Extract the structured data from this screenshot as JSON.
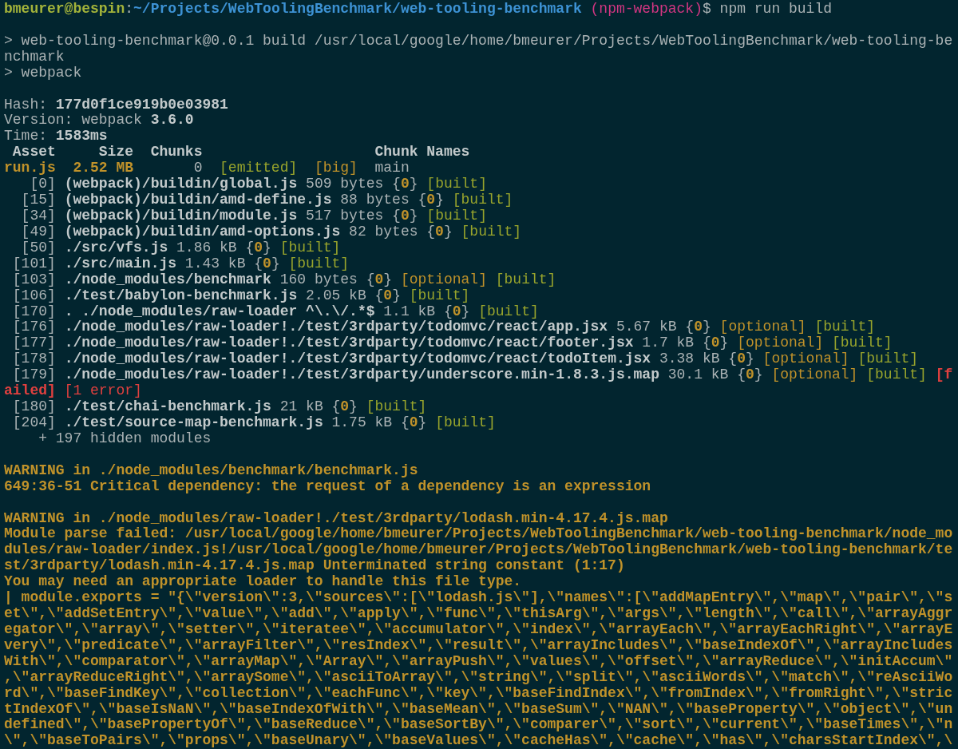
{
  "terminal": {
    "blocks": [
      {
        "lines": [
          {
            "segments": [
              {
                "kind": "user",
                "text": "bmeurer@bespin"
              },
              {
                "kind": "plain",
                "text": ":"
              },
              {
                "kind": "path",
                "text": "~/Projects/WebToolingBenchmark/web-tooling-benchmark"
              },
              {
                "kind": "branch",
                "text": " (npm-webpack)"
              },
              {
                "kind": "plain",
                "text": "$ npm run build"
              }
            ]
          }
        ]
      },
      {
        "lines": [
          {
            "segments": [
              {
                "kind": "plain",
                "text": "> web-tooling-benchmark@0.0.1 build /usr/local/google/home/bmeurer/Projects/WebToolingBenchmark/web-tooling-be"
              }
            ]
          },
          {
            "segments": [
              {
                "kind": "plain",
                "text": "nchmark"
              }
            ]
          },
          {
            "segments": [
              {
                "kind": "plain",
                "text": "> webpack"
              }
            ]
          }
        ]
      },
      {
        "lines": [
          {
            "segments": [
              {
                "kind": "plain",
                "text": "Hash: "
              },
              {
                "kind": "bold",
                "text": "177d0f1ce919b0e03981"
              }
            ]
          },
          {
            "segments": [
              {
                "kind": "plain",
                "text": "Version: webpack "
              },
              {
                "kind": "bold",
                "text": "3.6.0"
              }
            ]
          },
          {
            "segments": [
              {
                "kind": "plain",
                "text": "Time: "
              },
              {
                "kind": "bold",
                "text": "1583ms"
              }
            ]
          },
          {
            "segments": [
              {
                "kind": "bold",
                "text": " Asset     Size  Chunks                    Chunk Names"
              }
            ]
          },
          {
            "segments": [
              {
                "kind": "yellowbold",
                "text": "run.js  2.52 MB"
              },
              {
                "kind": "plain",
                "text": "       0  "
              },
              {
                "kind": "green",
                "text": "[emitted]"
              },
              {
                "kind": "yellow",
                "text": "  [big]"
              },
              {
                "kind": "plain",
                "text": "  main"
              }
            ]
          },
          {
            "segments": [
              {
                "kind": "plain",
                "text": "   [0] "
              },
              {
                "kind": "bold",
                "text": "(webpack)/buildin/global.js"
              },
              {
                "kind": "plain",
                "text": " 509 bytes {"
              },
              {
                "kind": "yellowbold",
                "text": "0"
              },
              {
                "kind": "plain",
                "text": "} "
              },
              {
                "kind": "green",
                "text": "[built]"
              }
            ]
          },
          {
            "segments": [
              {
                "kind": "plain",
                "text": "  [15] "
              },
              {
                "kind": "bold",
                "text": "(webpack)/buildin/amd-define.js"
              },
              {
                "kind": "plain",
                "text": " 88 bytes {"
              },
              {
                "kind": "yellowbold",
                "text": "0"
              },
              {
                "kind": "plain",
                "text": "} "
              },
              {
                "kind": "green",
                "text": "[built]"
              }
            ]
          },
          {
            "segments": [
              {
                "kind": "plain",
                "text": "  [34] "
              },
              {
                "kind": "bold",
                "text": "(webpack)/buildin/module.js"
              },
              {
                "kind": "plain",
                "text": " 517 bytes {"
              },
              {
                "kind": "yellowbold",
                "text": "0"
              },
              {
                "kind": "plain",
                "text": "} "
              },
              {
                "kind": "green",
                "text": "[built]"
              }
            ]
          },
          {
            "segments": [
              {
                "kind": "plain",
                "text": "  [49] "
              },
              {
                "kind": "bold",
                "text": "(webpack)/buildin/amd-options.js"
              },
              {
                "kind": "plain",
                "text": " 82 bytes {"
              },
              {
                "kind": "yellowbold",
                "text": "0"
              },
              {
                "kind": "plain",
                "text": "} "
              },
              {
                "kind": "green",
                "text": "[built]"
              }
            ]
          },
          {
            "segments": [
              {
                "kind": "plain",
                "text": "  [50] "
              },
              {
                "kind": "bold",
                "text": "./src/vfs.js"
              },
              {
                "kind": "plain",
                "text": " 1.86 kB {"
              },
              {
                "kind": "yellowbold",
                "text": "0"
              },
              {
                "kind": "plain",
                "text": "} "
              },
              {
                "kind": "green",
                "text": "[built]"
              }
            ]
          },
          {
            "segments": [
              {
                "kind": "plain",
                "text": " [101] "
              },
              {
                "kind": "bold",
                "text": "./src/main.js"
              },
              {
                "kind": "plain",
                "text": " 1.43 kB {"
              },
              {
                "kind": "yellowbold",
                "text": "0"
              },
              {
                "kind": "plain",
                "text": "} "
              },
              {
                "kind": "green",
                "text": "[built]"
              }
            ]
          },
          {
            "segments": [
              {
                "kind": "plain",
                "text": " [103] "
              },
              {
                "kind": "bold",
                "text": "./node_modules/benchmark"
              },
              {
                "kind": "plain",
                "text": " 160 bytes {"
              },
              {
                "kind": "yellowbold",
                "text": "0"
              },
              {
                "kind": "plain",
                "text": "} "
              },
              {
                "kind": "yellow",
                "text": "[optional]"
              },
              {
                "kind": "green",
                "text": " [built]"
              }
            ]
          },
          {
            "segments": [
              {
                "kind": "plain",
                "text": " [106] "
              },
              {
                "kind": "bold",
                "text": "./test/babylon-benchmark.js"
              },
              {
                "kind": "plain",
                "text": " 2.05 kB {"
              },
              {
                "kind": "yellowbold",
                "text": "0"
              },
              {
                "kind": "plain",
                "text": "} "
              },
              {
                "kind": "green",
                "text": "[built]"
              }
            ]
          },
          {
            "segments": [
              {
                "kind": "plain",
                "text": " [170] "
              },
              {
                "kind": "bold",
                "text": ". ./node_modules/raw-loader ^\\.\\/.*$"
              },
              {
                "kind": "plain",
                "text": " 1.1 kB {"
              },
              {
                "kind": "yellowbold",
                "text": "0"
              },
              {
                "kind": "plain",
                "text": "} "
              },
              {
                "kind": "green",
                "text": "[built]"
              }
            ]
          },
          {
            "segments": [
              {
                "kind": "plain",
                "text": " [176] "
              },
              {
                "kind": "bold",
                "text": "./node_modules/raw-loader!./test/3rdparty/todomvc/react/app.jsx"
              },
              {
                "kind": "plain",
                "text": " 5.67 kB {"
              },
              {
                "kind": "yellowbold",
                "text": "0"
              },
              {
                "kind": "plain",
                "text": "} "
              },
              {
                "kind": "yellow",
                "text": "[optional]"
              },
              {
                "kind": "green",
                "text": " [built]"
              }
            ]
          },
          {
            "segments": [
              {
                "kind": "plain",
                "text": " [177] "
              },
              {
                "kind": "bold",
                "text": "./node_modules/raw-loader!./test/3rdparty/todomvc/react/footer.jsx"
              },
              {
                "kind": "plain",
                "text": " 1.7 kB {"
              },
              {
                "kind": "yellowbold",
                "text": "0"
              },
              {
                "kind": "plain",
                "text": "} "
              },
              {
                "kind": "yellow",
                "text": "[optional]"
              },
              {
                "kind": "green",
                "text": " [built]"
              }
            ]
          },
          {
            "segments": [
              {
                "kind": "plain",
                "text": " [178] "
              },
              {
                "kind": "bold",
                "text": "./node_modules/raw-loader!./test/3rdparty/todomvc/react/todoItem.jsx"
              },
              {
                "kind": "plain",
                "text": " 3.38 kB {"
              },
              {
                "kind": "yellowbold",
                "text": "0"
              },
              {
                "kind": "plain",
                "text": "} "
              },
              {
                "kind": "yellow",
                "text": "[optional]"
              },
              {
                "kind": "green",
                "text": " [built]"
              }
            ]
          },
          {
            "segments": [
              {
                "kind": "plain",
                "text": " [179] "
              },
              {
                "kind": "bold",
                "text": "./node_modules/raw-loader!./test/3rdparty/underscore.min-1.8.3.js.map"
              },
              {
                "kind": "plain",
                "text": " 30.1 kB {"
              },
              {
                "kind": "yellowbold",
                "text": "0"
              },
              {
                "kind": "plain",
                "text": "} "
              },
              {
                "kind": "yellow",
                "text": "[optional]"
              },
              {
                "kind": "green",
                "text": " [built]"
              },
              {
                "kind": "redbold",
                "text": " [f"
              }
            ]
          },
          {
            "segments": [
              {
                "kind": "redbold",
                "text": "ailed]"
              },
              {
                "kind": "red",
                "text": " [1 error]"
              }
            ]
          },
          {
            "segments": [
              {
                "kind": "plain",
                "text": " [180] "
              },
              {
                "kind": "bold",
                "text": "./test/chai-benchmark.js"
              },
              {
                "kind": "plain",
                "text": " 21 kB {"
              },
              {
                "kind": "yellowbold",
                "text": "0"
              },
              {
                "kind": "plain",
                "text": "} "
              },
              {
                "kind": "green",
                "text": "[built]"
              }
            ]
          },
          {
            "segments": [
              {
                "kind": "plain",
                "text": " [204] "
              },
              {
                "kind": "bold",
                "text": "./test/source-map-benchmark.js"
              },
              {
                "kind": "plain",
                "text": " 1.75 kB {"
              },
              {
                "kind": "yellowbold",
                "text": "0"
              },
              {
                "kind": "plain",
                "text": "} "
              },
              {
                "kind": "green",
                "text": "[built]"
              }
            ]
          },
          {
            "segments": [
              {
                "kind": "plain",
                "text": "    + 197 hidden modules"
              }
            ]
          }
        ]
      },
      {
        "lines": [
          {
            "segments": [
              {
                "kind": "yellowbold",
                "text": "WARNING in ./node_modules/benchmark/benchmark.js"
              }
            ]
          },
          {
            "segments": [
              {
                "kind": "yellowbold",
                "text": "649:36-51 Critical dependency: the request of a dependency is an expression"
              }
            ]
          }
        ]
      },
      {
        "lines": [
          {
            "segments": [
              {
                "kind": "yellowbold",
                "text": "WARNING in ./node_modules/raw-loader!./test/3rdparty/lodash.min-4.17.4.js.map"
              }
            ]
          },
          {
            "segments": [
              {
                "kind": "yellowbold",
                "text": "Module parse failed: /usr/local/google/home/bmeurer/Projects/WebToolingBenchmark/web-tooling-benchmark/node_mo"
              }
            ]
          },
          {
            "segments": [
              {
                "kind": "yellowbold",
                "text": "dules/raw-loader/index.js!/usr/local/google/home/bmeurer/Projects/WebToolingBenchmark/web-tooling-benchmark/te"
              }
            ]
          },
          {
            "segments": [
              {
                "kind": "yellowbold",
                "text": "st/3rdparty/lodash.min-4.17.4.js.map Unterminated string constant (1:17)"
              }
            ]
          },
          {
            "segments": [
              {
                "kind": "yellowbold",
                "text": "You may need an appropriate loader to handle this file type."
              }
            ]
          },
          {
            "segments": [
              {
                "kind": "yellowbold",
                "text": "| module.exports = \"{\\\"version\\\":3,\\\"sources\\\":[\\\"lodash.js\\\"],\\\"names\\\":[\\\"addMapEntry\\\",\\\"map\\\",\\\"pair\\\",\\\"s"
              }
            ]
          },
          {
            "segments": [
              {
                "kind": "yellowbold",
                "text": "et\\\",\\\"addSetEntry\\\",\\\"value\\\",\\\"add\\\",\\\"apply\\\",\\\"func\\\",\\\"thisArg\\\",\\\"args\\\",\\\"length\\\",\\\"call\\\",\\\"arrayAggr"
              }
            ]
          },
          {
            "segments": [
              {
                "kind": "yellowbold",
                "text": "egator\\\",\\\"array\\\",\\\"setter\\\",\\\"iteratee\\\",\\\"accumulator\\\",\\\"index\\\",\\\"arrayEach\\\",\\\"arrayEachRight\\\",\\\"arrayE"
              }
            ]
          },
          {
            "segments": [
              {
                "kind": "yellowbold",
                "text": "very\\\",\\\"predicate\\\",\\\"arrayFilter\\\",\\\"resIndex\\\",\\\"result\\\",\\\"arrayIncludes\\\",\\\"baseIndexOf\\\",\\\"arrayIncludes"
              }
            ]
          },
          {
            "segments": [
              {
                "kind": "yellowbold",
                "text": "With\\\",\\\"comparator\\\",\\\"arrayMap\\\",\\\"Array\\\",\\\"arrayPush\\\",\\\"values\\\",\\\"offset\\\",\\\"arrayReduce\\\",\\\"initAccum\\\""
              }
            ]
          },
          {
            "segments": [
              {
                "kind": "yellowbold",
                "text": ",\\\"arrayReduceRight\\\",\\\"arraySome\\\",\\\"asciiToArray\\\",\\\"string\\\",\\\"split\\\",\\\"asciiWords\\\",\\\"match\\\",\\\"reAsciiWo"
              }
            ]
          },
          {
            "segments": [
              {
                "kind": "yellowbold",
                "text": "rd\\\",\\\"baseFindKey\\\",\\\"collection\\\",\\\"eachFunc\\\",\\\"key\\\",\\\"baseFindIndex\\\",\\\"fromIndex\\\",\\\"fromRight\\\",\\\"stric"
              }
            ]
          },
          {
            "segments": [
              {
                "kind": "yellowbold",
                "text": "tIndexOf\\\",\\\"baseIsNaN\\\",\\\"baseIndexOfWith\\\",\\\"baseMean\\\",\\\"baseSum\\\",\\\"NAN\\\",\\\"baseProperty\\\",\\\"object\\\",\\\"un"
              }
            ]
          },
          {
            "segments": [
              {
                "kind": "yellowbold",
                "text": "defined\\\",\\\"basePropertyOf\\\",\\\"baseReduce\\\",\\\"baseSortBy\\\",\\\"comparer\\\",\\\"sort\\\",\\\"current\\\",\\\"baseTimes\\\",\\\"n"
              }
            ]
          },
          {
            "segments": [
              {
                "kind": "yellowbold",
                "text": "\\\",\\\"baseToPairs\\\",\\\"props\\\",\\\"baseUnary\\\",\\\"baseValues\\\",\\\"cacheHas\\\",\\\"cache\\\",\\\"has\\\",\\\"charsStartIndex\\\",\\"
              }
            ]
          }
        ]
      }
    ]
  }
}
